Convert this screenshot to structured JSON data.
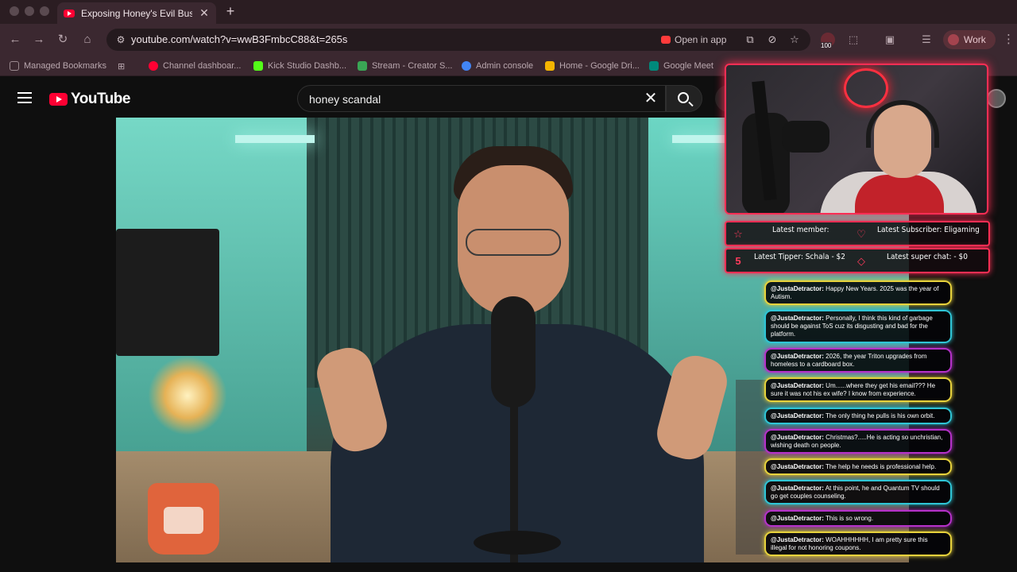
{
  "browser": {
    "tab_title": "Exposing Honey's Evil Busine",
    "url": "youtube.com/watch?v=wwB3FmbcC88&t=265s",
    "open_in_app": "Open in app",
    "extension_badge": "100",
    "profile_label": "Work",
    "bookmarks": [
      {
        "label": "Managed Bookmarks",
        "icon": "folder-icon",
        "color": "#9b8a90"
      },
      {
        "label": "Channel dashboar...",
        "icon": "youtube-favicon",
        "color": "#ff0033"
      },
      {
        "label": "Kick Studio Dashb...",
        "icon": "kick-favicon",
        "color": "#53fc18"
      },
      {
        "label": "Stream - Creator S...",
        "icon": "puzzle-favicon",
        "color": "#3aa655"
      },
      {
        "label": "Admin console",
        "icon": "google-favicon",
        "color": "#4285f4"
      },
      {
        "label": "Home - Google Dri...",
        "icon": "drive-favicon",
        "color": "#f4b400"
      },
      {
        "label": "Google Meet",
        "icon": "meet-favicon",
        "color": "#00897b"
      }
    ]
  },
  "youtube": {
    "logo_text": "YouTube",
    "search_query": "honey scandal"
  },
  "overlay": {
    "latest_member": "Latest member:",
    "latest_subscriber": "Latest Subscriber: Eligaming",
    "latest_tipper": "Latest Tipper: Schala - $2",
    "latest_super_chat": "Latest super chat:  - $0",
    "tipper_icon_text": "5",
    "accent_color": "#ff2e54",
    "chat": [
      {
        "user": "@JustaDetractor:",
        "text": "Happy New Years. 2025 was the year of Autism.",
        "color": "y"
      },
      {
        "user": "@JustaDetractor:",
        "text": "Personally, I think this kind of garbage should be against ToS cuz its disgusting and bad for the platform.",
        "color": "c"
      },
      {
        "user": "@JustaDetractor:",
        "text": "2026, the year Triton upgrades from homeless to a cardboard box.",
        "color": "p"
      },
      {
        "user": "@JustaDetractor:",
        "text": "Um......where they get his email??? He sure it was not his ex wife? I know from experience.",
        "color": "y"
      },
      {
        "user": "@JustaDetractor:",
        "text": "The only thing he pulls is his own orbit.",
        "color": "c"
      },
      {
        "user": "@JustaDetractor:",
        "text": "Christmas?.....He is acting so unchristian, wishing death on people.",
        "color": "p"
      },
      {
        "user": "@JustaDetractor:",
        "text": "The help he needs is professional help.",
        "color": "y"
      },
      {
        "user": "@JustaDetractor:",
        "text": "At this point, he and Quantum TV should go get couples counseling.",
        "color": "c"
      },
      {
        "user": "@JustaDetractor:",
        "text": "This is so wrong.",
        "color": "p"
      },
      {
        "user": "@JustaDetractor:",
        "text": "WOAHHHHHH, I am pretty sure this illegal for not honoring coupons.",
        "color": "y"
      }
    ]
  }
}
